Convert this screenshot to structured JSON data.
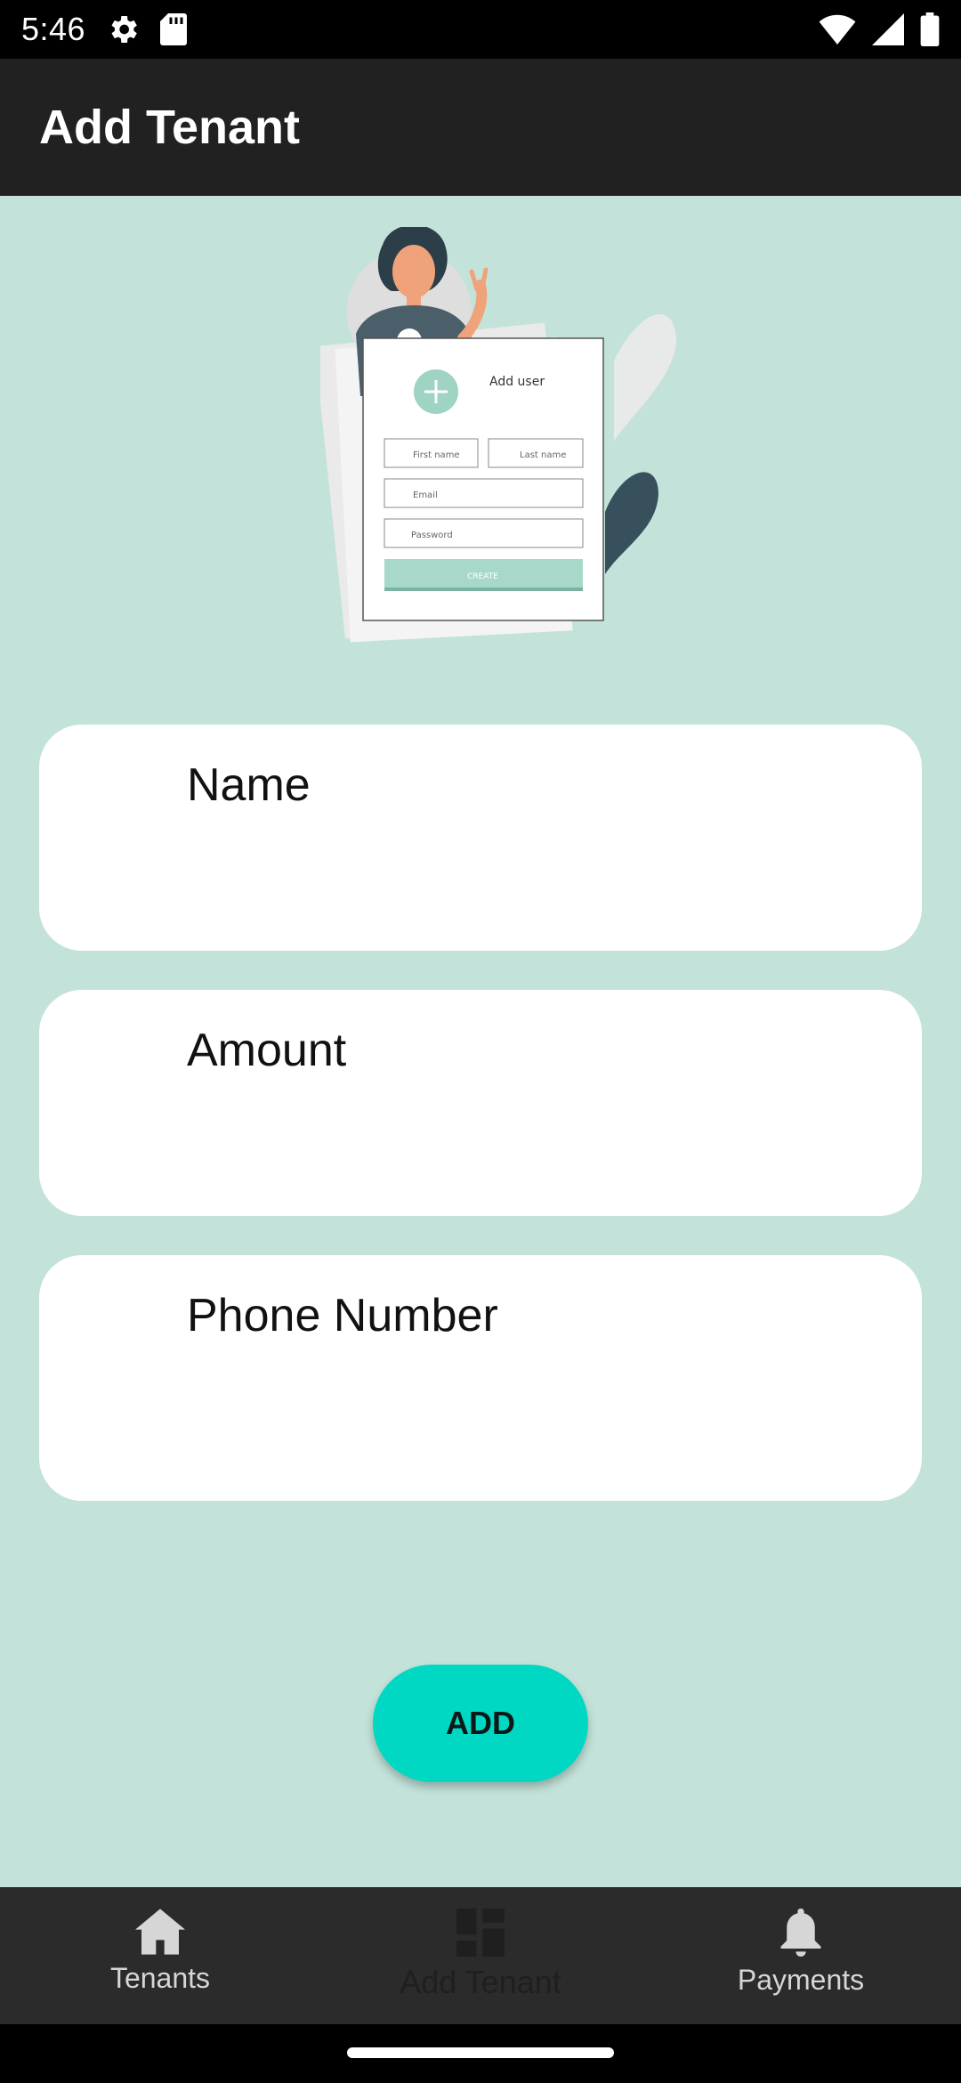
{
  "status_bar": {
    "time": "5:46",
    "icons_left": [
      "settings-gear-icon",
      "sd-card-icon"
    ],
    "icons_right": [
      "wifi-icon",
      "cell-signal-icon",
      "battery-icon"
    ]
  },
  "app_bar": {
    "title": "Add Tenant"
  },
  "illustration": {
    "card_title": "Add user",
    "first_name": "First name",
    "last_name": "Last name",
    "email": "Email",
    "password": "Password",
    "create": "CREATE"
  },
  "form": {
    "fields": [
      {
        "label": "Name",
        "value": ""
      },
      {
        "label": "Amount",
        "value": ""
      },
      {
        "label": "Phone Number",
        "value": ""
      }
    ],
    "add_label": "ADD"
  },
  "bottom_nav": {
    "items": [
      {
        "label": "Tenants",
        "icon": "home-icon"
      },
      {
        "label": "Add Tenant",
        "icon": "dashboard-icon",
        "active": true
      },
      {
        "label": "Payments",
        "icon": "bell-icon"
      }
    ]
  },
  "colors": {
    "background": "#c3e3da",
    "app_bar": "#212121",
    "accent": "#00d8c3",
    "nav_bar": "#2b2b2b"
  }
}
